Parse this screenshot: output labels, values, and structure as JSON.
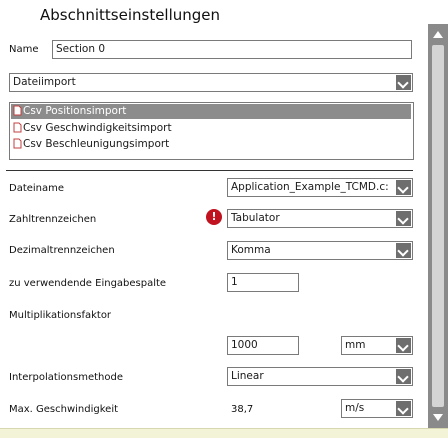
{
  "title": "Abschnittseinstellungen",
  "name_label": "Name",
  "name_value": "Section 0",
  "import_type": "Dateiimport",
  "import_list": [
    {
      "label": "Csv Positionsimport",
      "selected": true
    },
    {
      "label": "Csv Geschwindigkeitsimport",
      "selected": false
    },
    {
      "label": "Csv Beschleunigungsimport",
      "selected": false
    }
  ],
  "fields": {
    "dateiname": {
      "label": "Dateiname",
      "value": "Application_Example_TCMD.c:"
    },
    "zahltrenn": {
      "label": "Zahltrennzeichen",
      "value": "Tabulator",
      "warning": "!"
    },
    "dezimal": {
      "label": "Dezimaltrennzeichen",
      "value": "Komma"
    },
    "spalte": {
      "label": "zu verwendende Eingabespalte",
      "value": "1"
    },
    "faktor": {
      "label": "Multiplikationsfaktor",
      "value": "1000",
      "unit": "mm"
    },
    "interp": {
      "label": "Interpolationsmethode",
      "value": "Linear"
    },
    "maxgesch": {
      "label": "Max. Geschwindigkeit",
      "value": "38,7",
      "unit": "m/s"
    }
  },
  "colors": {
    "accent_selected": "#8c8c8c",
    "warning": "#c1121f",
    "scrollbar": "#8a8a8a"
  }
}
